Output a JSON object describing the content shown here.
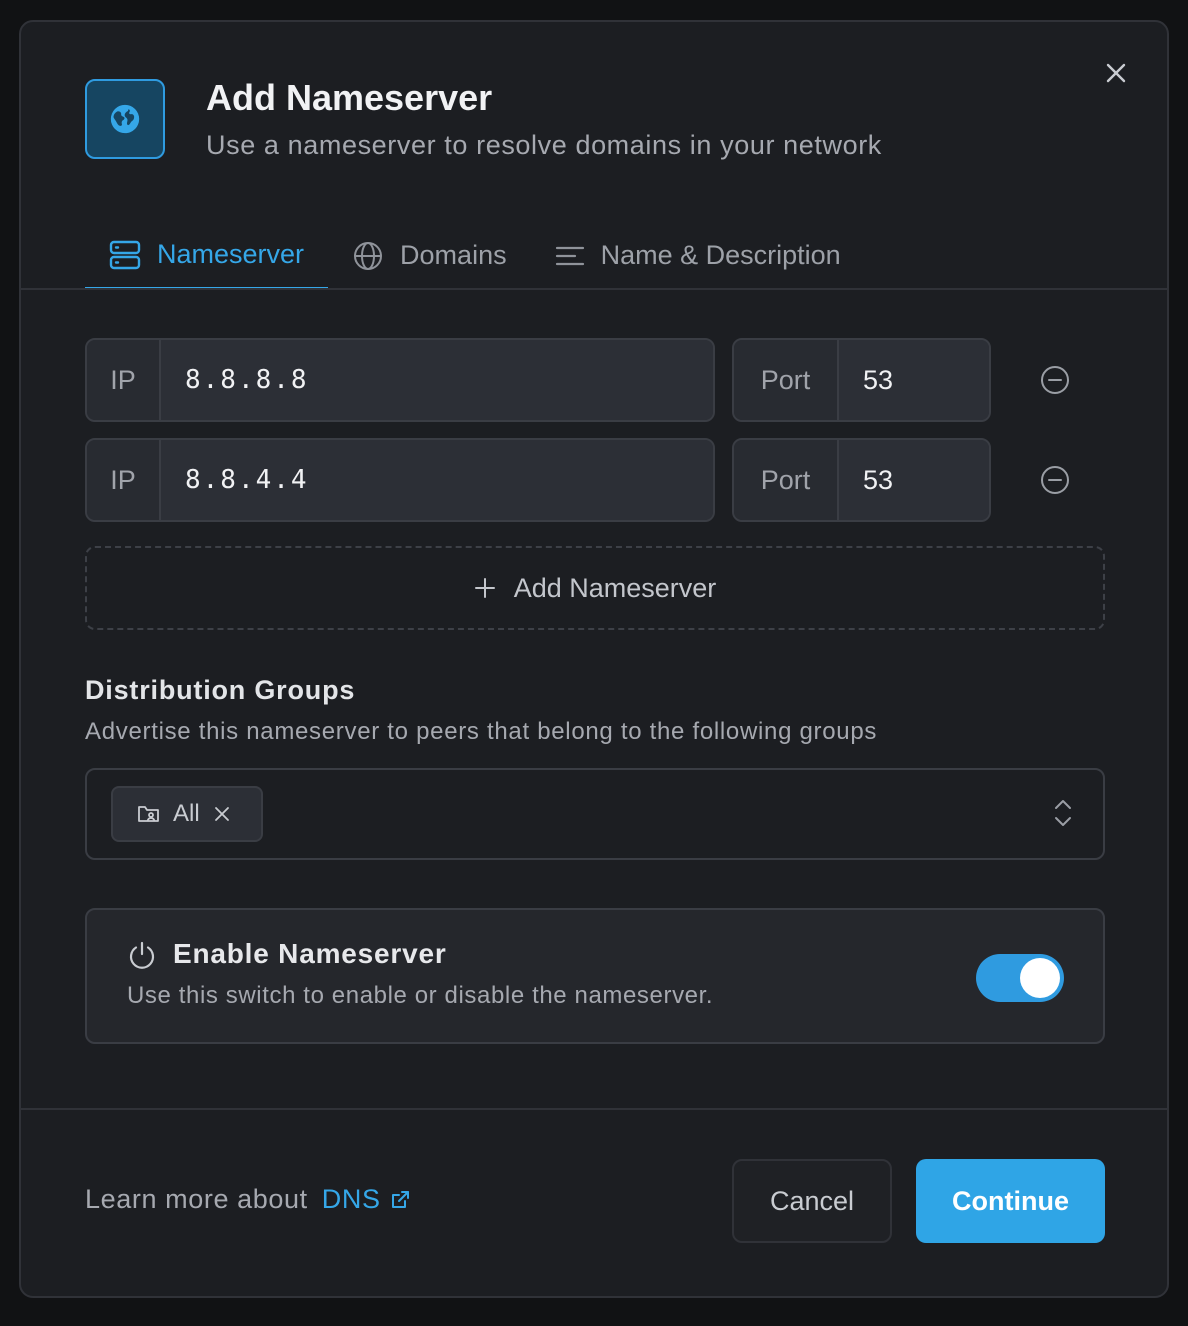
{
  "dialog": {
    "title": "Add Nameserver",
    "subtitle": "Use a nameserver to resolve domains in your network"
  },
  "tabs": [
    {
      "label": "Nameserver",
      "icon": "server-icon",
      "active": true
    },
    {
      "label": "Domains",
      "icon": "globe-icon",
      "active": false
    },
    {
      "label": "Name & Description",
      "icon": "text-lines-icon",
      "active": false
    }
  ],
  "nameservers": [
    {
      "ip_label": "IP",
      "ip": "8.8.8.8",
      "port_label": "Port",
      "port": "53"
    },
    {
      "ip_label": "IP",
      "ip": "8.8.4.4",
      "port_label": "Port",
      "port": "53"
    }
  ],
  "add_nameserver_label": "Add Nameserver",
  "distribution_groups": {
    "title": "Distribution Groups",
    "subtitle": "Advertise this nameserver to peers that belong to the following groups",
    "selected": [
      {
        "label": "All"
      }
    ]
  },
  "enable": {
    "title": "Enable Nameserver",
    "subtitle": "Use this switch to enable or disable the nameserver.",
    "enabled": true
  },
  "footer": {
    "learn_prefix": "Learn more about",
    "learn_link": "DNS",
    "cancel_label": "Cancel",
    "continue_label": "Continue"
  },
  "colors": {
    "accent": "#2fa5e6",
    "background": "#1c1e22",
    "surface": "#2c2f36"
  }
}
